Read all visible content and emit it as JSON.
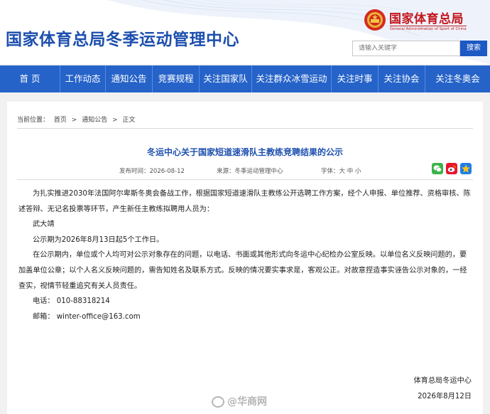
{
  "header": {
    "site_title": "国家体育总局冬季运动管理中心",
    "logo_cn": "国家体育总局",
    "logo_en": "General Administration of Sport of China",
    "search_placeholder": "请输入关键字",
    "search_button": "搜索"
  },
  "nav": {
    "items": [
      "首 页",
      "工作动态",
      "通知公告",
      "竞赛规程",
      "关注国家队",
      "关注群众冰雪运动",
      "关注时事",
      "关注协会",
      "关注冬奥会"
    ]
  },
  "breadcrumb": {
    "label": "当前位置：",
    "items": [
      "首页",
      "通知公告",
      "正文"
    ],
    "separator": ">"
  },
  "article": {
    "title": "冬运中心关于国家短道速滑队主教练竞聘结果的公示",
    "publish_time": "发布时间：2026-08-12",
    "source": "来源：冬季运动管理中心",
    "font_size": "字体：大 中 小",
    "paragraphs": [
      "为扎实推进2030年法国阿尔卑斯冬奥会备战工作，根据国家短道速滑队主教练公开选聘工作方案，经个人申报、单位推荐、资格审核、陈述答辩、无记名投票等环节，产生新任主教练拟聘用人员为：",
      "武大靖",
      "公示期为2026年8月13日起5个工作日。",
      "在公示期内，单位或个人均可对公示对象存在的问题，以电话、书面或其他形式向冬运中心纪检办公室反映。以单位名义反映问题的，要加盖单位公章；以个人名义反映问题的，需告知姓名及联系方式。反映的情况要实事求是，客观公正。对故意捏造事实诬告公示对象的，一经查实，视情节轻重追究有关人员责任。"
    ],
    "phone": "电话：  010-88318214",
    "email": "邮箱：  winter-office@163.com",
    "signature_org": "体育总局冬运中心",
    "signature_date": "2026年8月12日"
  },
  "share_icons": [
    "wechat-icon",
    "weibo-icon",
    "qzone-icon"
  ],
  "watermark": "@华商网",
  "colors": {
    "brand_blue": "#1d4fae",
    "nav_blue": "#2563c9",
    "logo_red": "#c4161c"
  }
}
